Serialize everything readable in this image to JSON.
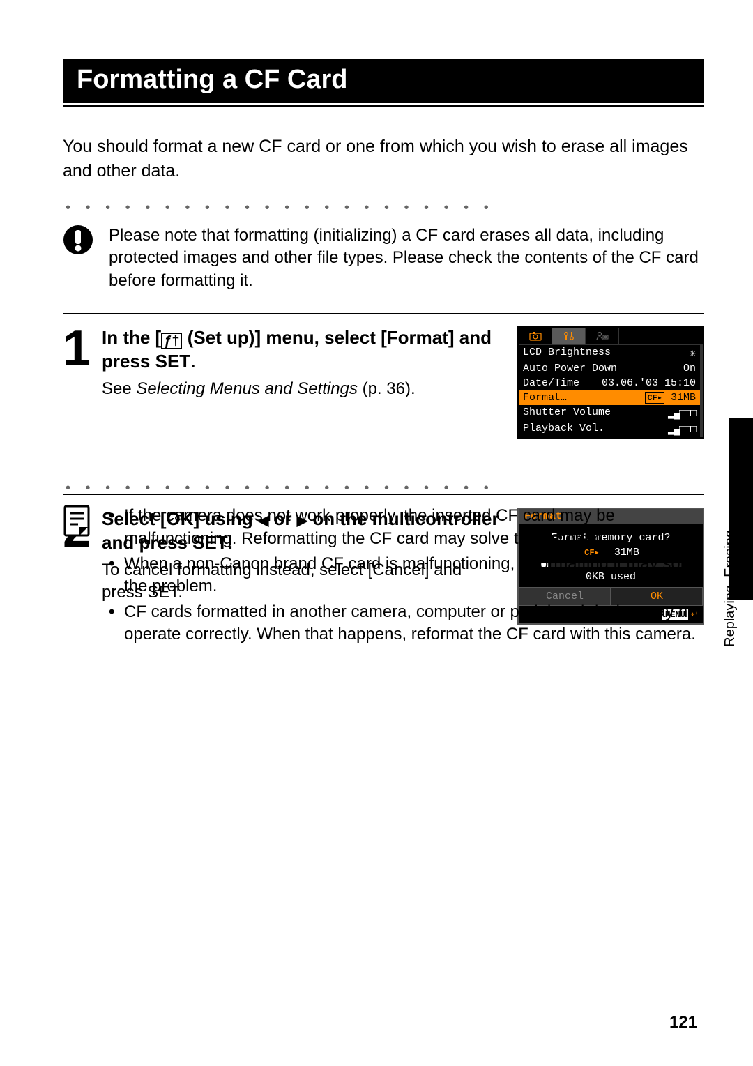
{
  "page": {
    "title": "Formatting a CF Card",
    "intro": "You should format a new CF card or one from which you wish to erase all images and other data.",
    "warning": "Please note that formatting (initializing) a CF card erases all data, including protected images and other file types. Please check the contents of the CF card before formatting it.",
    "side_label": "Replaying, Erasing",
    "page_number": "121"
  },
  "step1": {
    "num": "1",
    "title_pre": "In the [",
    "title_post": " (Set up)] menu, select [Format] and press ",
    "title_bold": "SET",
    "title_end": ".",
    "desc_pre": "See ",
    "desc_italic": "Selecting Menus and Settings",
    "desc_post": " (p. 36).",
    "screen": {
      "rows": {
        "r0_label": "LCD Brightness",
        "r0_val": "✳",
        "r1_label": "Auto Power Down",
        "r1_val": "On",
        "r2_label": "Date/Time",
        "r2_val": "03.06.'03 15:10",
        "r3_label": "Format…",
        "r3_cf": "CF▸",
        "r3_val": "31MB",
        "r4_label": "Shutter Volume",
        "r4_val": "▂▄□□□",
        "r5_label": "Playback Vol.",
        "r5_val": "▂▄□□□"
      }
    }
  },
  "step2": {
    "num": "2",
    "title_pre": "Select [OK] using ",
    "arrow_left": "◀",
    "title_mid": " or ",
    "arrow_right": "▶",
    "title_post": " on the multicontroller and press ",
    "title_bold": "SET",
    "title_end": ".",
    "desc_pre": "To cancel formatting instead, select [Cancel] and press ",
    "desc_bold": "SET",
    "desc_end": ".",
    "screen": {
      "header": "Format",
      "q": "Format memory card?",
      "cf": "CF▸",
      "size": "31MB",
      "used": "0KB used",
      "cancel": "Cancel",
      "ok": "OK",
      "menu": "MENU",
      "return": "↩"
    }
  },
  "notes": {
    "n0": "If the camera does not work properly, the inserted CF card may be malfunctioning. Reformatting the CF card may solve the problem.",
    "n1": "When a non-Canon brand CF card is malfunctioning, reformatting it may solve the problem.",
    "n2": "CF cards formatted in another camera, computer or peripheral device may not operate correctly. When that happens, reformat the CF card with this camera."
  }
}
